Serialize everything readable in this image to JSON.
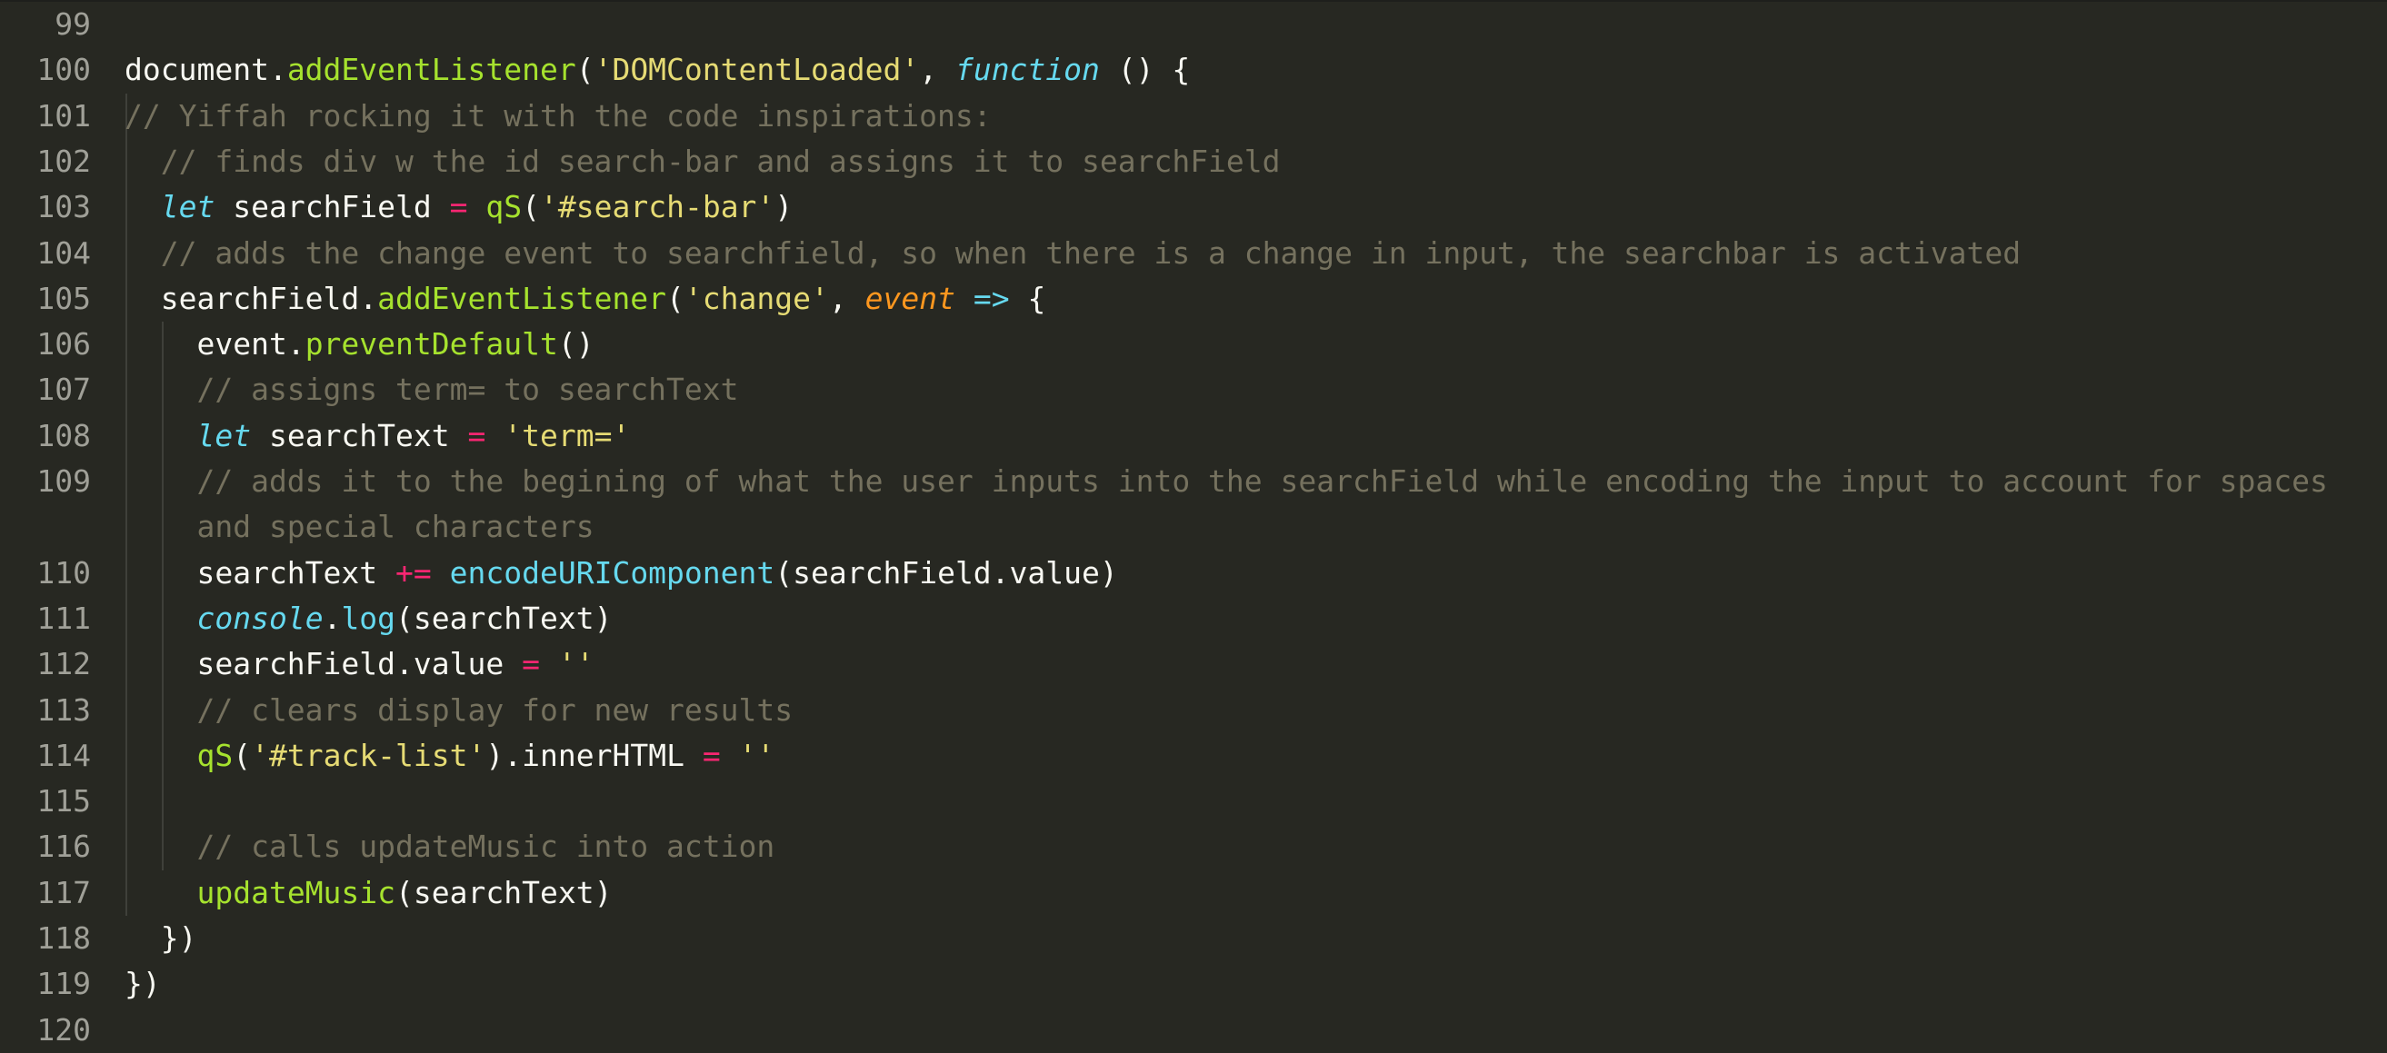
{
  "editor": {
    "theme_colors": {
      "background": "#272822",
      "comment": "#75715e",
      "string": "#e6db74",
      "function": "#a6e22e",
      "keyword": "#66d9ef",
      "operator": "#f92672",
      "parameter": "#fd971f",
      "gutter_text": "#a0a098"
    },
    "lines": [
      {
        "number": "99",
        "tokens": []
      },
      {
        "number": "100",
        "tokens": [
          {
            "t": "document.",
            "c": "pl"
          },
          {
            "t": "addEventListener",
            "c": "fn"
          },
          {
            "t": "(",
            "c": "pl"
          },
          {
            "t": "'DOMContentLoaded'",
            "c": "st"
          },
          {
            "t": ", ",
            "c": "pl"
          },
          {
            "t": "function",
            "c": "kw"
          },
          {
            "t": " () {",
            "c": "pl"
          }
        ]
      },
      {
        "number": "101",
        "tokens": [
          {
            "t": "// Yiffah rocking it with the code inspirations:",
            "c": "cm"
          }
        ]
      },
      {
        "number": "102",
        "tokens": [
          {
            "t": "  // finds div w the id search-bar and assigns it to searchField",
            "c": "cm"
          }
        ]
      },
      {
        "number": "103",
        "tokens": [
          {
            "t": "  ",
            "c": "pl"
          },
          {
            "t": "let",
            "c": "kw"
          },
          {
            "t": " searchField ",
            "c": "pl"
          },
          {
            "t": "=",
            "c": "op"
          },
          {
            "t": " ",
            "c": "pl"
          },
          {
            "t": "qS",
            "c": "fn"
          },
          {
            "t": "(",
            "c": "pl"
          },
          {
            "t": "'#search-bar'",
            "c": "st"
          },
          {
            "t": ")",
            "c": "pl"
          }
        ]
      },
      {
        "number": "104",
        "tokens": [
          {
            "t": "  // adds the change event to searchfield, so when there is a change in input, the searchbar is activated",
            "c": "cm"
          }
        ]
      },
      {
        "number": "105",
        "tokens": [
          {
            "t": "  searchField.",
            "c": "pl"
          },
          {
            "t": "addEventListener",
            "c": "fn"
          },
          {
            "t": "(",
            "c": "pl"
          },
          {
            "t": "'change'",
            "c": "st"
          },
          {
            "t": ", ",
            "c": "pl"
          },
          {
            "t": "event",
            "c": "pa"
          },
          {
            "t": " ",
            "c": "pl"
          },
          {
            "t": "=>",
            "c": "bi"
          },
          {
            "t": " {",
            "c": "pl"
          }
        ]
      },
      {
        "number": "106",
        "tokens": [
          {
            "t": "    event.",
            "c": "pl"
          },
          {
            "t": "preventDefault",
            "c": "fn"
          },
          {
            "t": "()",
            "c": "pl"
          }
        ]
      },
      {
        "number": "107",
        "tokens": [
          {
            "t": "    // assigns term= to searchText",
            "c": "cm"
          }
        ]
      },
      {
        "number": "108",
        "tokens": [
          {
            "t": "    ",
            "c": "pl"
          },
          {
            "t": "let",
            "c": "kw"
          },
          {
            "t": " searchText ",
            "c": "pl"
          },
          {
            "t": "=",
            "c": "op"
          },
          {
            "t": " ",
            "c": "pl"
          },
          {
            "t": "'term='",
            "c": "st"
          }
        ]
      },
      {
        "number": "109",
        "tokens": [
          {
            "t": "    // adds it to the begining of what the user inputs into the searchField while encoding the input to account for spaces",
            "c": "cm"
          }
        ]
      },
      {
        "number": "",
        "tokens": [
          {
            "t": "    and special characters",
            "c": "cm"
          }
        ]
      },
      {
        "number": "110",
        "tokens": [
          {
            "t": "    searchText ",
            "c": "pl"
          },
          {
            "t": "+=",
            "c": "op"
          },
          {
            "t": " ",
            "c": "pl"
          },
          {
            "t": "encodeURIComponent",
            "c": "bi"
          },
          {
            "t": "(searchField.value)",
            "c": "pl"
          }
        ]
      },
      {
        "number": "111",
        "tokens": [
          {
            "t": "    ",
            "c": "pl"
          },
          {
            "t": "console",
            "c": "kw"
          },
          {
            "t": ".",
            "c": "pl"
          },
          {
            "t": "log",
            "c": "bi"
          },
          {
            "t": "(searchText)",
            "c": "pl"
          }
        ]
      },
      {
        "number": "112",
        "tokens": [
          {
            "t": "    searchField.value ",
            "c": "pl"
          },
          {
            "t": "=",
            "c": "op"
          },
          {
            "t": " ",
            "c": "pl"
          },
          {
            "t": "''",
            "c": "st"
          }
        ]
      },
      {
        "number": "113",
        "tokens": [
          {
            "t": "    // clears display for new results",
            "c": "cm"
          }
        ]
      },
      {
        "number": "114",
        "tokens": [
          {
            "t": "    ",
            "c": "pl"
          },
          {
            "t": "qS",
            "c": "fn"
          },
          {
            "t": "(",
            "c": "pl"
          },
          {
            "t": "'#track-list'",
            "c": "st"
          },
          {
            "t": ").innerHTML ",
            "c": "pl"
          },
          {
            "t": "=",
            "c": "op"
          },
          {
            "t": " ",
            "c": "pl"
          },
          {
            "t": "''",
            "c": "st"
          }
        ]
      },
      {
        "number": "115",
        "tokens": []
      },
      {
        "number": "116",
        "tokens": [
          {
            "t": "    // calls updateMusic into action",
            "c": "cm"
          }
        ]
      },
      {
        "number": "117",
        "tokens": [
          {
            "t": "    ",
            "c": "pl"
          },
          {
            "t": "updateMusic",
            "c": "fn"
          },
          {
            "t": "(searchText)",
            "c": "pl"
          }
        ]
      },
      {
        "number": "118",
        "tokens": [
          {
            "t": "  })",
            "c": "pl"
          }
        ]
      },
      {
        "number": "119",
        "tokens": [
          {
            "t": "})",
            "c": "pl"
          }
        ]
      },
      {
        "number": "120",
        "tokens": []
      }
    ]
  }
}
